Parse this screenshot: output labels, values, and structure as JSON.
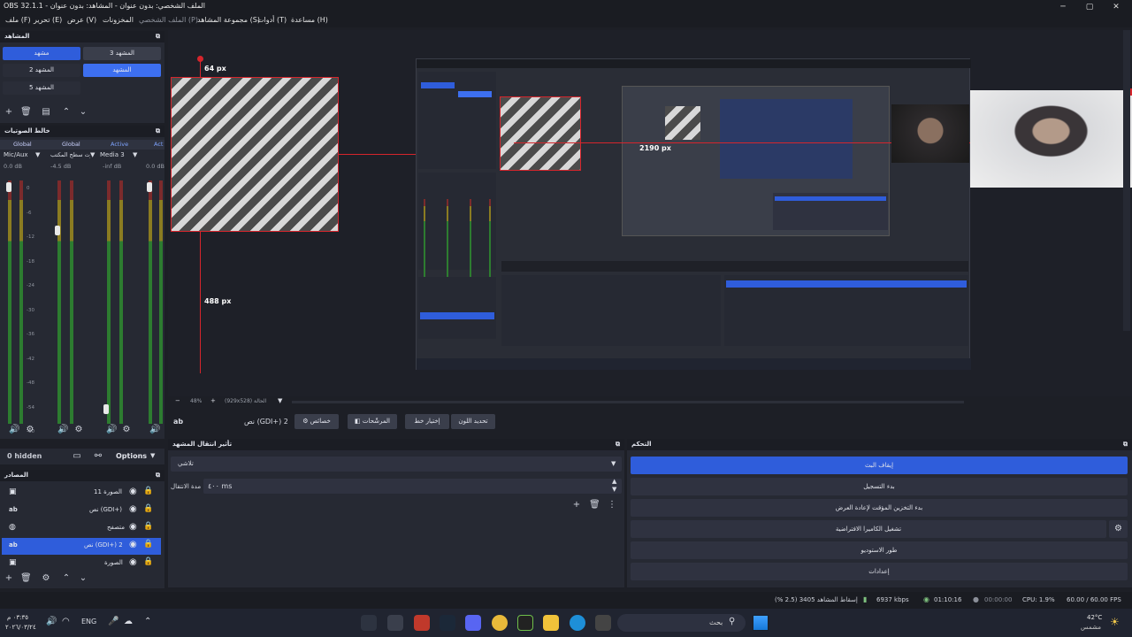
{
  "window": {
    "title": "OBS 32.1.1 - الملف الشخصي: بدون عنوان - المشاهد: بدون عنوان"
  },
  "menu": [
    "ملف (F)",
    "تحرير (E)",
    "عرض (V)",
    "المخزونات",
    "الملف الشخصي (P)",
    "مجموعة المشاهد (S)",
    "أدوات (T)",
    "مساعدة (H)"
  ],
  "scenes": {
    "header": "المشاهد",
    "items": [
      "مشهد",
      "المشهد 3",
      "المشهد 2",
      "المشهد",
      "المشهد 5"
    ],
    "selected_index": 3
  },
  "mixer": {
    "header": "خالط الصوتيات",
    "tabs": [
      "Global",
      "Global",
      "Active",
      "Act"
    ],
    "channels": [
      {
        "name": "Mic/Aux",
        "db": "0.0 dB",
        "level": 0.97
      },
      {
        "name": "صوت سطح المكتب",
        "db": "-4.5 dB",
        "level": 0.79
      },
      {
        "name": "Media 3",
        "db": "-inf dB",
        "level": 0.04
      },
      {
        "name": "",
        "db": "0.0 dB",
        "level": 0.97
      }
    ],
    "scale": [
      "0",
      "-6",
      "-12",
      "-18",
      "-24",
      "-30",
      "-36",
      "-42",
      "-48",
      "-54",
      "-60"
    ],
    "hidden_label": "0 hidden",
    "options_label": "Options"
  },
  "sources": {
    "header": "المصادر",
    "items": [
      {
        "name": "الصورة 11",
        "icon": "image-icon"
      },
      {
        "name": "نص (GDI+)",
        "icon": "text-icon"
      },
      {
        "name": "متصفح",
        "icon": "browser-icon"
      },
      {
        "name": "نص (GDI+) 2",
        "icon": "text-icon",
        "selected": true
      },
      {
        "name": "الصورة",
        "icon": "image-icon"
      }
    ]
  },
  "preview": {
    "label_top": "64 px",
    "label_bottom": "488 px",
    "label_mid": "2190 px",
    "zoom": "48%",
    "canvas_info": "(929x528) الحالة"
  },
  "props_toolbar": {
    "source_name": "نص (GDI+) 2",
    "buttons": [
      "خصائص",
      "المرشّحات",
      "إختيار خط",
      "تحديد اللون"
    ]
  },
  "transitions": {
    "header": "تأثير انتقال المشهد",
    "select_value": "تلاشي",
    "duration_label": "مدة الانتقال",
    "duration_value": "٤٠٠ ms"
  },
  "controls": {
    "header": "التحكم",
    "buttons": [
      "إيقاف البث",
      "بدء التسجيل",
      "بدء التخزين المؤقت لإعادة العرض",
      "تشغيل الكاميرا الافتراضية",
      "طور الاستوديو",
      "إعدادات"
    ]
  },
  "status": {
    "dropped": "إسقاط المشاهد 3405 (2.5 %)",
    "bitrate": "6937 kbps",
    "stream_time": "01:10:16",
    "rec_time": "00:00:00",
    "cpu": "CPU: 1.9%",
    "fps": "60.00 / 60.00 FPS"
  },
  "taskbar": {
    "time": "٠٣:٣٥ م",
    "date": "٢٠٢٦/٠٣/٢٤",
    "lang": "ENG",
    "search": "بحث",
    "weather_temp": "42°C",
    "weather_desc": "مشمس"
  },
  "colors": {
    "accent": "#2f5ddb",
    "red": "#d6252c",
    "panel": "#262933",
    "bg": "#1d1f26"
  }
}
